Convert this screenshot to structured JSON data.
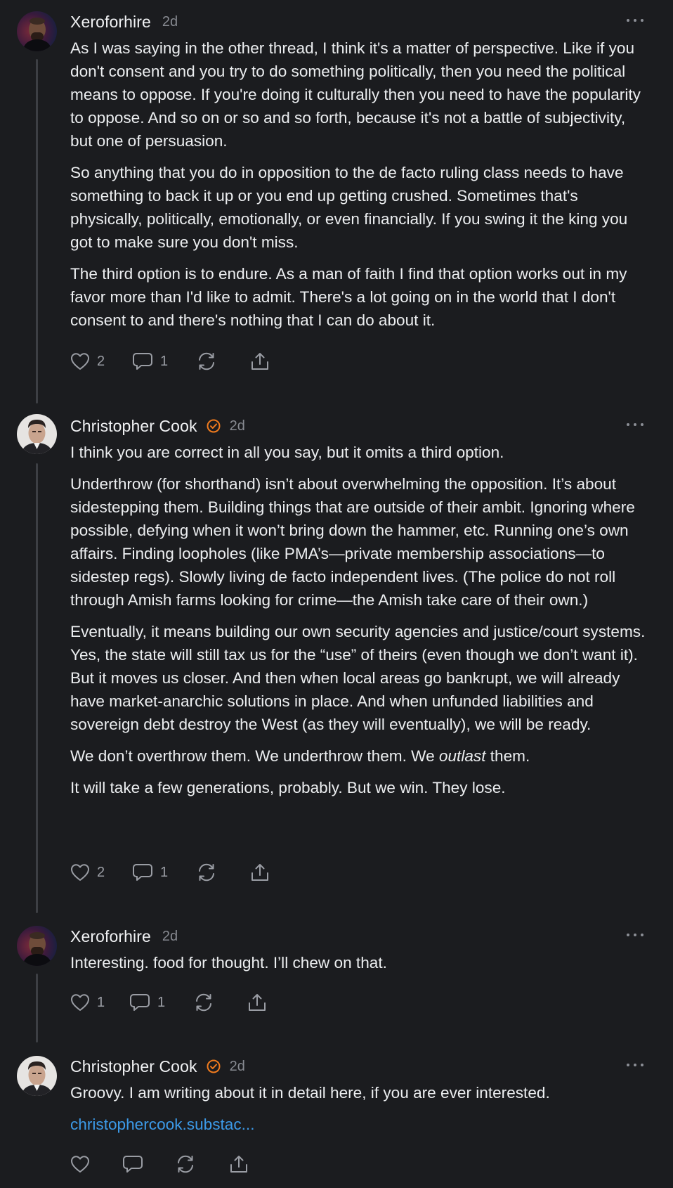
{
  "comments": [
    {
      "author": "Xeroforhire",
      "time": "2d",
      "verified": false,
      "paragraphs": [
        "As I was saying in the other thread, I think it's a matter of perspective. Like if you don't consent and you try to do something politically, then you need the political means to oppose. If you're doing it culturally then you need to have the popularity to oppose. And so on or so and so forth, because it's not a battle of subjectivity, but one of persuasion.",
        "So anything that you do in opposition to the de facto ruling class needs to have something to back it up or you end up getting crushed. Sometimes that's physically, politically, emotionally, or even financially. If you swing it the king you got to make sure you don't miss.",
        "The third option is to endure. As a man of faith I find that option works out in my favor more than I'd like to admit. There's a lot going on in the world that I don't consent to and there's nothing that I can do about it."
      ],
      "likes": "2",
      "replies": "1"
    },
    {
      "author": "Christopher Cook",
      "time": "2d",
      "verified": true,
      "paragraphs": [
        "I think you are correct in all you say, but it omits a third option.",
        "Underthrow (for shorthand) isn’t about overwhelming the opposition. It’s about sidestepping them. Building things that are outside of their ambit. Ignoring where possible, defying when it won’t bring down the hammer, etc. Running one’s own affairs. Finding loopholes (like PMA’s—private membership associations—to sidestep regs). Slowly living de facto independent lives. (The police do not roll through Amish farms looking for crime—the Amish take care of their own.)",
        "Eventually, it means building our own security agencies and justice/court systems. Yes, the state will still tax us for the “use” of theirs (even though we don’t want it). But it moves us closer. And then when local areas go bankrupt, we will already have market-anarchic solutions in place. And when unfunded liabilities and sovereign debt destroy the West (as they will eventually), we will be ready."
      ],
      "outlast_line": {
        "before": "We don’t overthrow them. We underthrow them. We ",
        "em": "outlast",
        "after": " them."
      },
      "closing": "It will take a few generations, probably. But we win. They lose.",
      "likes": "2",
      "replies": "1"
    },
    {
      "author": "Xeroforhire",
      "time": "2d",
      "verified": false,
      "paragraphs": [
        "Interesting. food for thought. I’ll chew on that."
      ],
      "likes": "1",
      "replies": "1"
    },
    {
      "author": "Christopher Cook",
      "time": "2d",
      "verified": true,
      "paragraphs": [
        "Groovy. I am writing about it in detail here, if you are ever interested."
      ],
      "link_text": "christophercook.substac...",
      "likes": "",
      "replies": ""
    }
  ],
  "icons": {
    "like": "heart-icon",
    "reply": "comment-bubble-icon",
    "restack": "restack-icon",
    "share": "share-icon",
    "more": "more-horizontal-icon",
    "verified": "verified-badge-icon"
  },
  "colors": {
    "background": "#1b1c1f",
    "text": "#eceef0",
    "muted": "#878a91",
    "verified_badge": "#f07b1e",
    "link": "#3c9ae8"
  }
}
